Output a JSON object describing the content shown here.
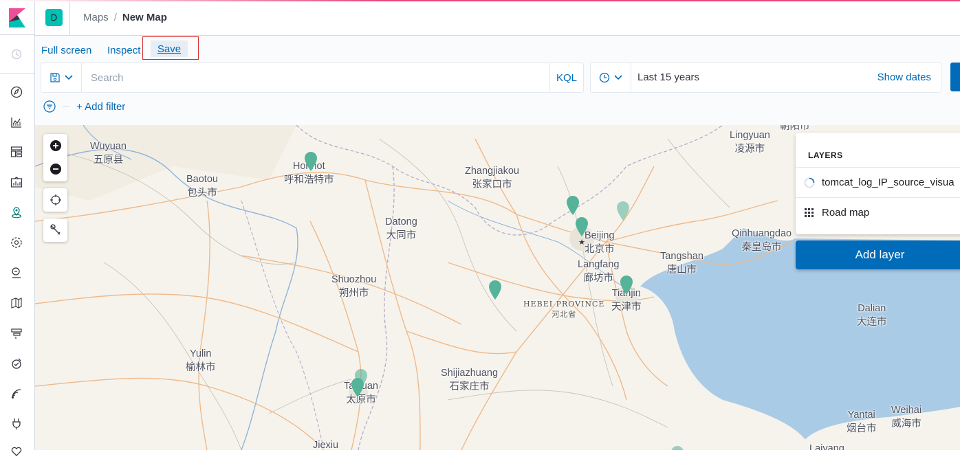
{
  "app": {
    "space_initial": "D"
  },
  "breadcrumbs": [
    {
      "label": "Maps"
    },
    {
      "label": "New Map"
    }
  ],
  "breadcrumb_separator": "/",
  "top_menu": {
    "fullscreen": "Full screen",
    "inspect": "Inspect",
    "save": "Save"
  },
  "query": {
    "placeholder": "Search",
    "value": "",
    "language": "KQL"
  },
  "time": {
    "range": "Last 15 years",
    "show_dates": "Show dates"
  },
  "filters": {
    "add_filter": "+ Add filter"
  },
  "map": {
    "labels": [
      {
        "en": "Wuyuan",
        "zh": "五原县"
      },
      {
        "en": "Baotou",
        "zh": "包头市"
      },
      {
        "en": "Hohhot",
        "zh": "呼和浩特市"
      },
      {
        "en": "Zhangjiakou",
        "zh": "张家口市"
      },
      {
        "en": "Lingyuan",
        "zh": "凌源市"
      },
      {
        "en": "Datong",
        "zh": "大同市"
      },
      {
        "en": "Beijing",
        "zh": "北京市"
      },
      {
        "en": "Langfang",
        "zh": "廊坊市"
      },
      {
        "en": "Qinhuangdao",
        "zh": "秦皇岛市"
      },
      {
        "en": "Tangshan",
        "zh": "唐山市"
      },
      {
        "en": "Shuozhou",
        "zh": "朔州市"
      },
      {
        "en": "HEBEI PROVINCE",
        "zh": "河北省"
      },
      {
        "en": "Tianjin",
        "zh": "天津市"
      },
      {
        "en": "Dalian",
        "zh": "大连市"
      },
      {
        "en": "Yulin",
        "zh": "榆林市"
      },
      {
        "en": "Shijiazhuang",
        "zh": "石家庄市"
      },
      {
        "en": "Taiyuan",
        "zh": "太原市"
      },
      {
        "en": "Yantai",
        "zh": "烟台市"
      },
      {
        "en": "Weihai",
        "zh": "威海市"
      },
      {
        "en": "Jiexiu",
        "zh": ""
      },
      {
        "en": "Laiyang",
        "zh": ""
      }
    ],
    "edge_text": "朝阳市"
  },
  "layers_panel": {
    "title": "LAYERS",
    "layers": [
      {
        "name": "tomcat_log_IP_source_visua",
        "icon": "loading-circle-icon"
      },
      {
        "name": "Road map",
        "icon": "grid-icon"
      }
    ],
    "add_layer": "Add layer"
  },
  "colors": {
    "accent": "#006bb8",
    "pin": "#54b399",
    "save_highlight_border": "#d83030",
    "space_badge": "#00bfb3",
    "water": "#aacbe5"
  }
}
